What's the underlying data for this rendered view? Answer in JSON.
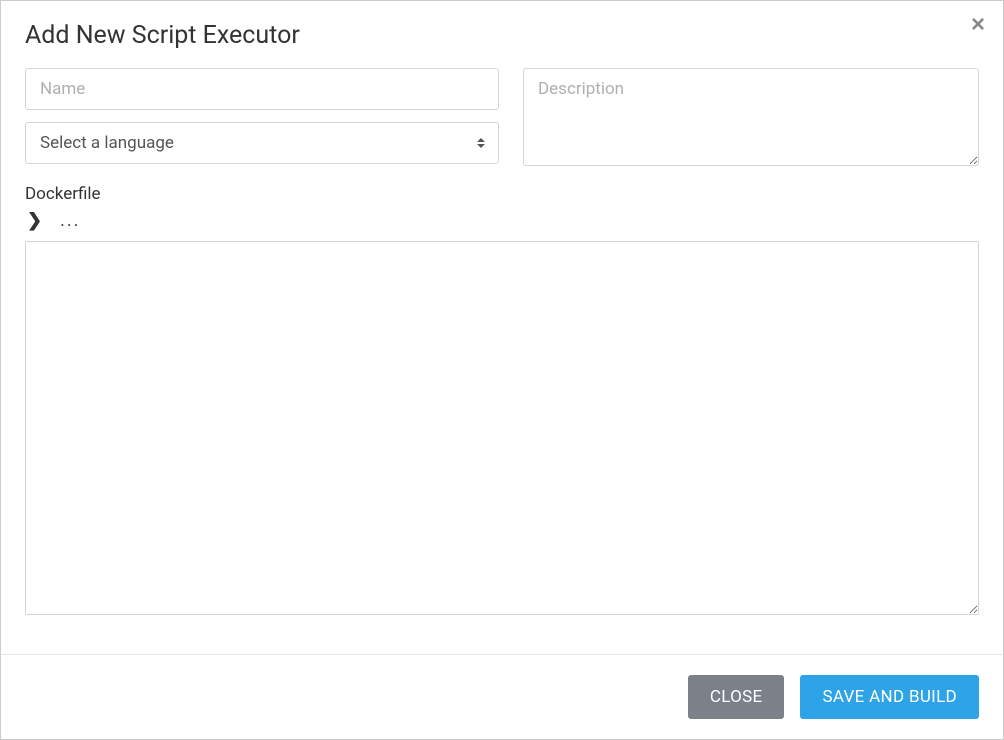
{
  "modal": {
    "title": "Add New Script Executor",
    "close_symbol": "×"
  },
  "form": {
    "name": {
      "placeholder": "Name",
      "value": ""
    },
    "language": {
      "placeholder": "Select a language",
      "value": ""
    },
    "description": {
      "placeholder": "Description",
      "value": ""
    },
    "dockerfile": {
      "label": "Dockerfile",
      "chevron": "❯",
      "ellipsis": "...",
      "value": ""
    }
  },
  "footer": {
    "close_label": "CLOSE",
    "save_label": "SAVE AND BUILD"
  }
}
